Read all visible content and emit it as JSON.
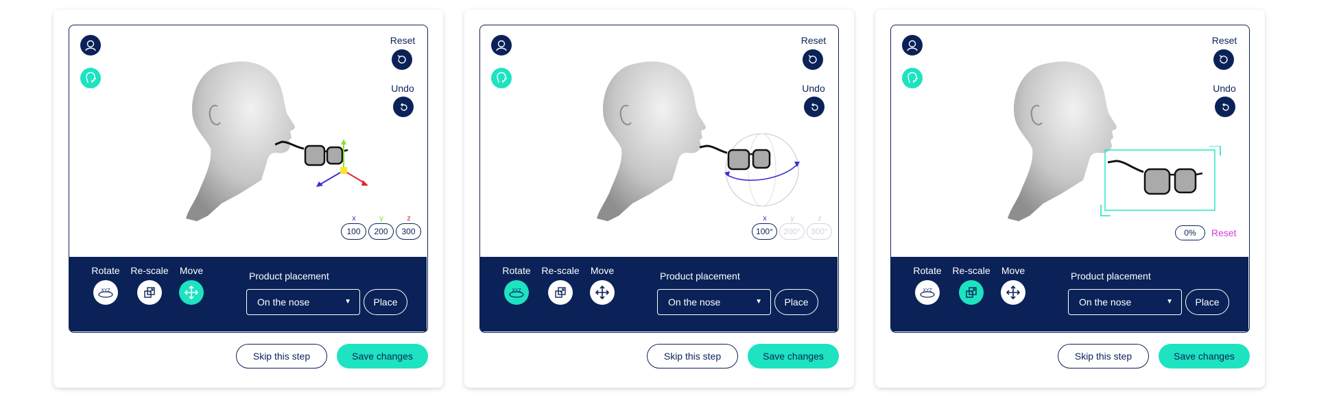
{
  "colors": {
    "navy": "#0a2257",
    "teal": "#1de3c0",
    "magenta": "#d23cd8",
    "axis_x": "#3a2fd6",
    "axis_y": "#8de02b",
    "axis_z": "#e0262e"
  },
  "labels": {
    "reset": "Reset",
    "undo": "Undo",
    "rotate": "Rotate",
    "rescale": "Re-scale",
    "move": "Move",
    "xyz": "XYZ",
    "product_placement": "Product placement",
    "placement_value": "On the nose",
    "place": "Place",
    "skip": "Skip this step",
    "save": "Save changes"
  },
  "icons": {
    "profile": "profile-icon",
    "head_side": "head-side-icon",
    "reset": "reset-icon",
    "undo": "undo-icon",
    "rotate": "rotate-xyz-icon",
    "rescale": "rescale-icon",
    "move": "move-arrows-icon",
    "dropdown": "chevron-down-icon"
  },
  "panels": [
    {
      "mode": "move",
      "active_tool": "move",
      "axis_labels": [
        "x",
        "y",
        "z"
      ],
      "axis_values": [
        "100",
        "200",
        "300"
      ]
    },
    {
      "mode": "rotate",
      "active_tool": "rotate",
      "axis_labels": [
        "x",
        "y",
        "z"
      ],
      "axis_values": [
        "100°",
        "200°",
        "300°"
      ]
    },
    {
      "mode": "rescale",
      "active_tool": "rescale",
      "scale_value": "0%",
      "scale_reset": "Reset"
    }
  ]
}
